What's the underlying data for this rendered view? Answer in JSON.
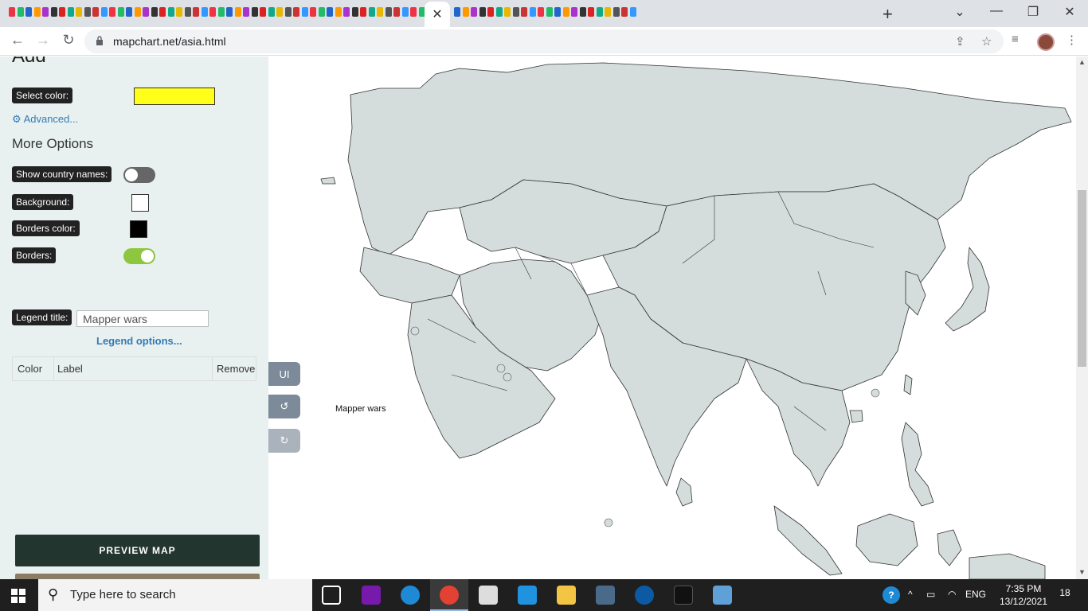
{
  "browser": {
    "url": "mapchart.net/asia.html",
    "tab_favicon_count": 72,
    "favicon_colors": [
      "#e34",
      "#2b6",
      "#26c",
      "#f90",
      "#a3c",
      "#333",
      "#d22",
      "#1a8",
      "#e6b800",
      "#555",
      "#c33",
      "#39f"
    ]
  },
  "panel": {
    "cut_title": "Add",
    "select_color_label": "Select color:",
    "select_color_value": "#ffff1a",
    "advanced_link": "Advanced...",
    "more_options_heading": "More Options",
    "show_names_label": "Show country names:",
    "show_names_on": false,
    "background_label": "Background:",
    "background_color": "#ffffff",
    "borders_color_label": "Borders color:",
    "borders_color": "#000000",
    "borders_label": "Borders:",
    "borders_on": true,
    "legend_title_label": "Legend title:",
    "legend_title_value": "Mapper wars",
    "legend_options_link": "Legend options...",
    "legend_table": {
      "color_header": "Color",
      "label_header": "Label",
      "remove_header": "Remove"
    },
    "preview_button": "PREVIEW MAP"
  },
  "map": {
    "ui_button": "UI",
    "undo_icon": "undo-icon",
    "redo_icon": "redo-icon",
    "legend_text": "Mapper wars",
    "land_color": "#d4dcdc",
    "border_color": "#333333"
  },
  "taskbar": {
    "search_placeholder": "Type here to search",
    "language": "ENG",
    "time": "7:35 PM",
    "date": "13/12/2021",
    "notification_count": "18"
  }
}
